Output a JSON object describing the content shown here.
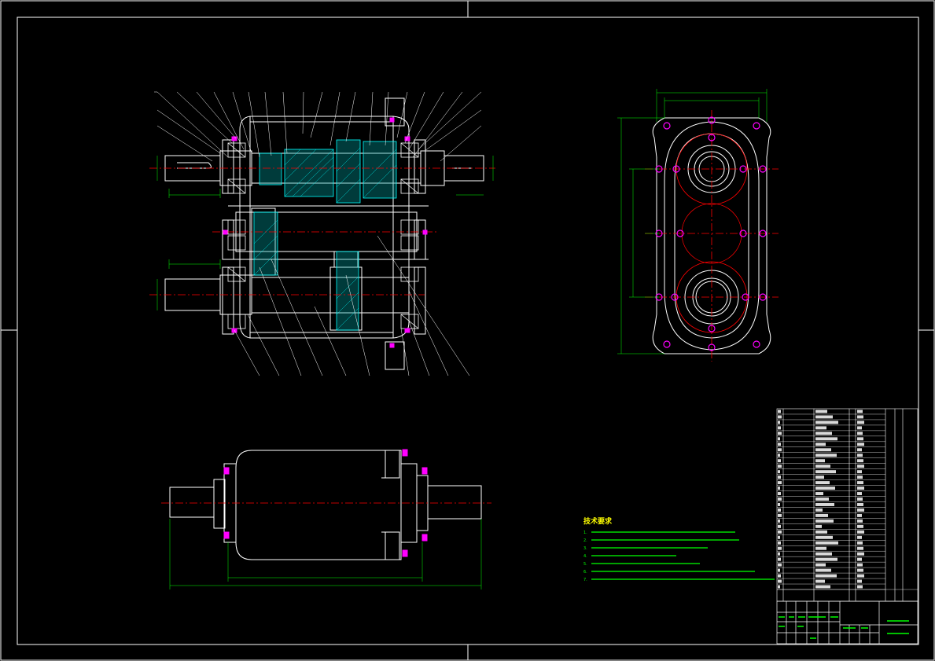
{
  "drawing": {
    "type": "CAD assembly drawing",
    "background": "#000000",
    "colors": {
      "outline": "#ffffff",
      "dimension": "#00ff00",
      "centerline": "#ff0000",
      "hatch": "#00ffff",
      "bolt": "#ff00ff",
      "note_title": "#ffff00",
      "gear_circle": "#ff0000"
    }
  },
  "technical_notes": {
    "title": "技术要求",
    "lines": [
      "1.",
      "2.",
      "3.",
      "4.",
      "5.",
      "6.",
      "7."
    ]
  },
  "title_block": {
    "drawing_title": "",
    "drawing_number": ""
  }
}
